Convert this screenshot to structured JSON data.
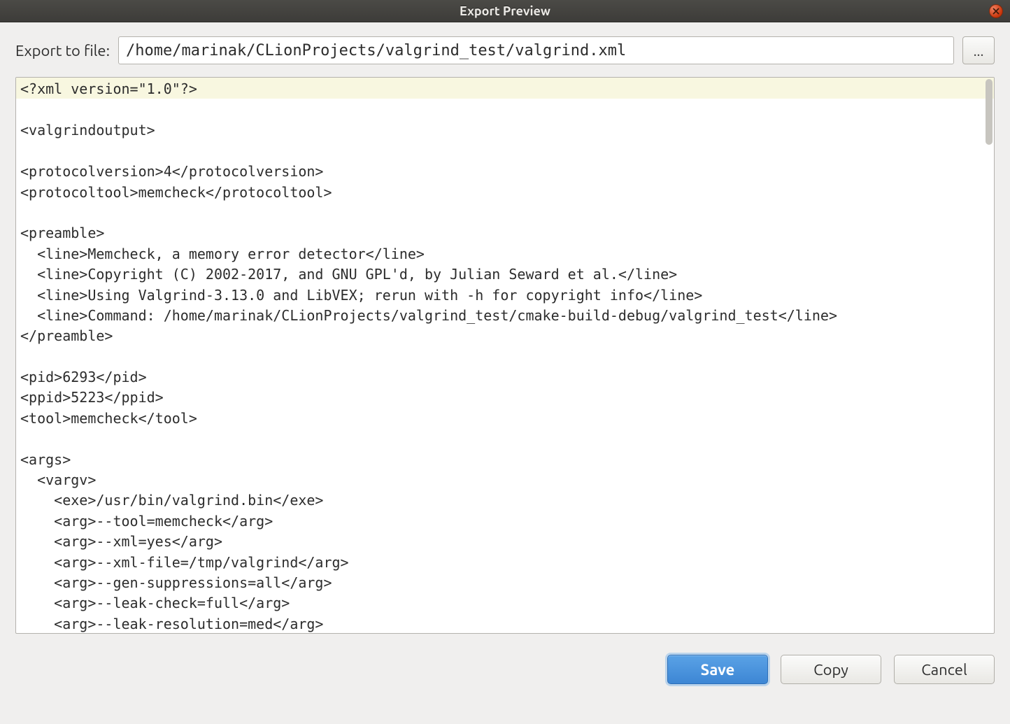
{
  "window": {
    "title": "Export Preview"
  },
  "form": {
    "file_label": "Export to file:",
    "file_value": "/home/marinak/CLionProjects/valgrind_test/valgrind.xml",
    "browse_label": "..."
  },
  "preview": {
    "xml_declaration": "<?xml version=\"1.0\"?>",
    "body": "\n<valgrindoutput>\n\n<protocolversion>4</protocolversion>\n<protocoltool>memcheck</protocoltool>\n\n<preamble>\n  <line>Memcheck, a memory error detector</line>\n  <line>Copyright (C) 2002-2017, and GNU GPL'd, by Julian Seward et al.</line>\n  <line>Using Valgrind-3.13.0 and LibVEX; rerun with -h for copyright info</line>\n  <line>Command: /home/marinak/CLionProjects/valgrind_test/cmake-build-debug/valgrind_test</line>\n</preamble>\n\n<pid>6293</pid>\n<ppid>5223</ppid>\n<tool>memcheck</tool>\n\n<args>\n  <vargv>\n    <exe>/usr/bin/valgrind.bin</exe>\n    <arg>--tool=memcheck</arg>\n    <arg>--xml=yes</arg>\n    <arg>--xml-file=/tmp/valgrind</arg>\n    <arg>--gen-suppressions=all</arg>\n    <arg>--leak-check=full</arg>\n    <arg>--leak-resolution=med</arg>"
  },
  "buttons": {
    "save": "Save",
    "copy": "Copy",
    "cancel": "Cancel"
  }
}
